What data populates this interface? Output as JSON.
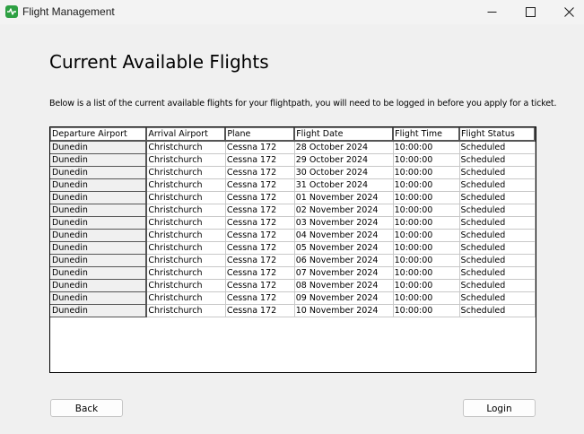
{
  "window": {
    "title": "Flight Management",
    "accent": "#2ea043"
  },
  "page": {
    "title": "Current Available Flights",
    "description": "Below is a list of the current available flights for your flightpath, you will need to be logged in before you apply for a ticket."
  },
  "table": {
    "headers": [
      "Departure Airport",
      "Arrival Airport",
      "Plane",
      "Flight Date",
      "Flight Time",
      "Flight Status"
    ],
    "rows": [
      [
        "Dunedin",
        "Christchurch",
        "Cessna 172",
        "28 October 2024",
        "10:00:00",
        "Scheduled"
      ],
      [
        "Dunedin",
        "Christchurch",
        "Cessna 172",
        "29 October 2024",
        "10:00:00",
        "Scheduled"
      ],
      [
        "Dunedin",
        "Christchurch",
        "Cessna 172",
        "30 October 2024",
        "10:00:00",
        "Scheduled"
      ],
      [
        "Dunedin",
        "Christchurch",
        "Cessna 172",
        "31 October 2024",
        "10:00:00",
        "Scheduled"
      ],
      [
        "Dunedin",
        "Christchurch",
        "Cessna 172",
        "01 November 2024",
        "10:00:00",
        "Scheduled"
      ],
      [
        "Dunedin",
        "Christchurch",
        "Cessna 172",
        "02 November 2024",
        "10:00:00",
        "Scheduled"
      ],
      [
        "Dunedin",
        "Christchurch",
        "Cessna 172",
        "03 November 2024",
        "10:00:00",
        "Scheduled"
      ],
      [
        "Dunedin",
        "Christchurch",
        "Cessna 172",
        "04 November 2024",
        "10:00:00",
        "Scheduled"
      ],
      [
        "Dunedin",
        "Christchurch",
        "Cessna 172",
        "05 November 2024",
        "10:00:00",
        "Scheduled"
      ],
      [
        "Dunedin",
        "Christchurch",
        "Cessna 172",
        "06 November 2024",
        "10:00:00",
        "Scheduled"
      ],
      [
        "Dunedin",
        "Christchurch",
        "Cessna 172",
        "07 November 2024",
        "10:00:00",
        "Scheduled"
      ],
      [
        "Dunedin",
        "Christchurch",
        "Cessna 172",
        "08 November 2024",
        "10:00:00",
        "Scheduled"
      ],
      [
        "Dunedin",
        "Christchurch",
        "Cessna 172",
        "09 November 2024",
        "10:00:00",
        "Scheduled"
      ],
      [
        "Dunedin",
        "Christchurch",
        "Cessna 172",
        "10 November 2024",
        "10:00:00",
        "Scheduled"
      ]
    ]
  },
  "buttons": {
    "back_label": "Back",
    "login_label": "Login"
  }
}
